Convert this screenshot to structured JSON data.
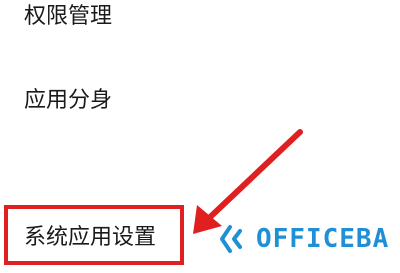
{
  "settings_list": {
    "items": [
      {
        "label": "权限管理"
      },
      {
        "label": "应用分身"
      },
      {
        "label": "系统应用设置"
      }
    ],
    "highlighted_index": 2
  },
  "annotation": {
    "color": "#e02020"
  },
  "watermark": {
    "text": "OFFICEBA",
    "color": "#1f8fd6",
    "icon": "officeba-logo-icon"
  }
}
